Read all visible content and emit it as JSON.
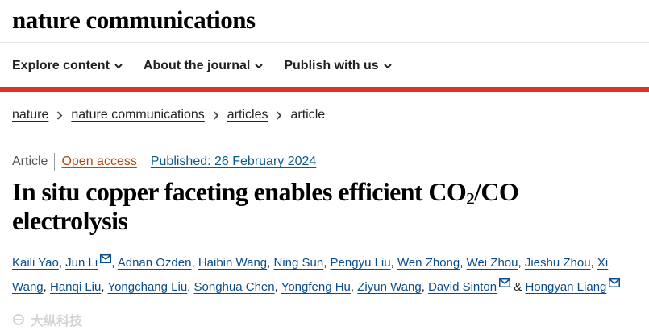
{
  "brand": {
    "name": "nature communications"
  },
  "nav": {
    "items": [
      {
        "label": "Explore content"
      },
      {
        "label": "About the journal"
      },
      {
        "label": "Publish with us"
      }
    ]
  },
  "breadcrumb": {
    "items": [
      "nature",
      "nature communications",
      "articles"
    ],
    "current": "article"
  },
  "meta": {
    "type": "Article",
    "access": "Open access",
    "published": "Published: 26 February 2024"
  },
  "title": {
    "part1": "In situ copper faceting enables efficient CO",
    "subscript": "2",
    "part2": "/CO electrolysis"
  },
  "authors": {
    "list": [
      "Kaili Yao",
      "Jun Li",
      "Adnan Ozden",
      "Haibin Wang",
      "Ning Sun",
      "Pengyu Liu",
      "Wen Zhong",
      "Wei Zhou",
      "Jieshu Zhou",
      "Xi Wang",
      "Hanqi Liu",
      "Yongchang Liu",
      "Songhua Chen",
      "Yongfeng Hu",
      "Ziyun Wang",
      "David Sinton",
      "Hongyan Liang"
    ],
    "separator": ", ",
    "and": " & "
  },
  "watermark": {
    "text": "大纵科技"
  },
  "colors": {
    "accent_bar": "#e13323",
    "link": "#0a4d8c",
    "open_access": "#b04a10"
  },
  "icons": {
    "nav_chevron": "chevron-down-icon",
    "breadcrumb_sep": "chevron-right-icon",
    "corresponding": "mail-icon"
  }
}
